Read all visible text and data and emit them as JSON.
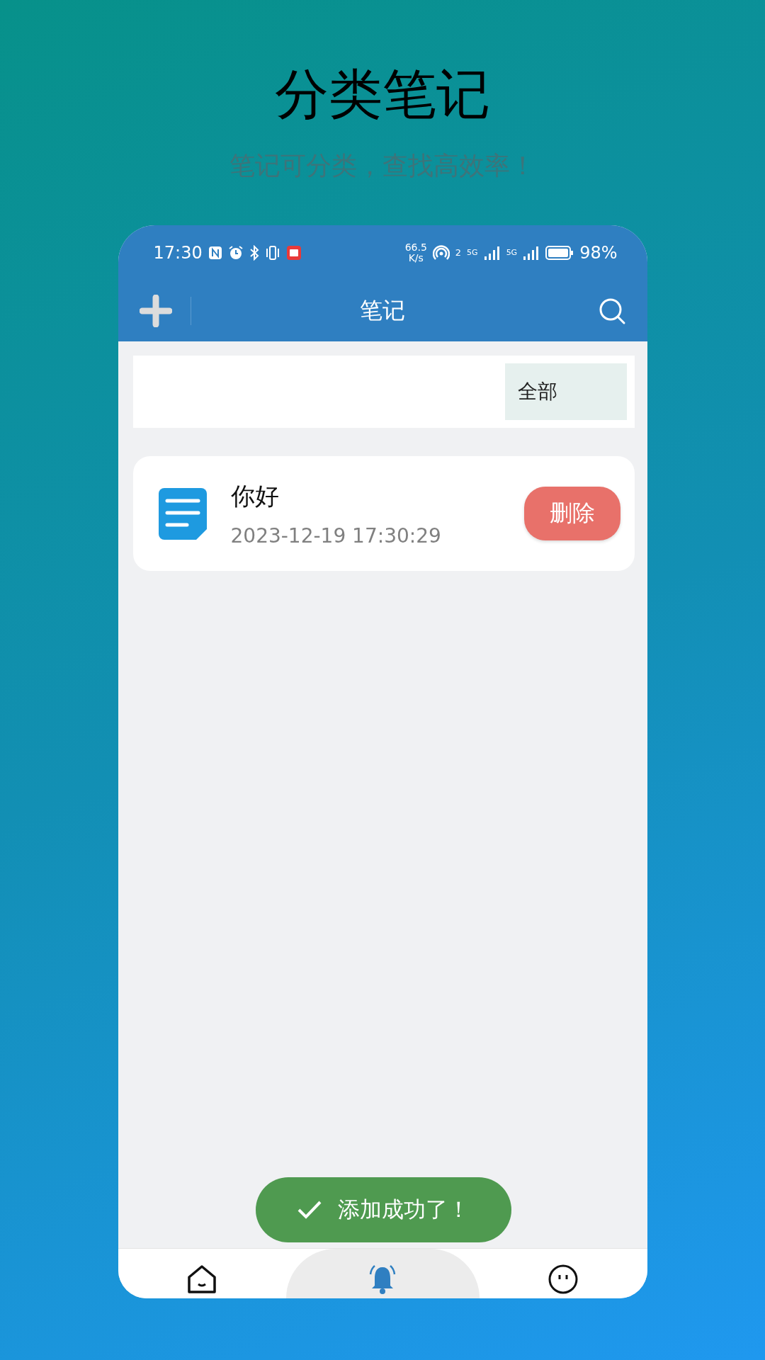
{
  "page": {
    "title": "分类笔记",
    "subtitle": "笔记可分类，查找高效率！"
  },
  "status_bar": {
    "time": "17:30",
    "speed_value": "66.5",
    "speed_unit": "K/s",
    "hotspot_count": "2",
    "sim1_network": "5G",
    "sim2_network": "5G",
    "battery": "98%"
  },
  "nav_bar": {
    "title": "笔记"
  },
  "category_filter": [
    {
      "label": "全部",
      "selected": true
    }
  ],
  "notes": [
    {
      "title": "你好",
      "date": "2023-12-19 17:30:29",
      "action": "删除"
    }
  ],
  "toast": {
    "message": "添加成功了！"
  },
  "tab_bar": [
    {
      "selected": false
    },
    {
      "selected": true
    },
    {
      "selected": false
    }
  ]
}
